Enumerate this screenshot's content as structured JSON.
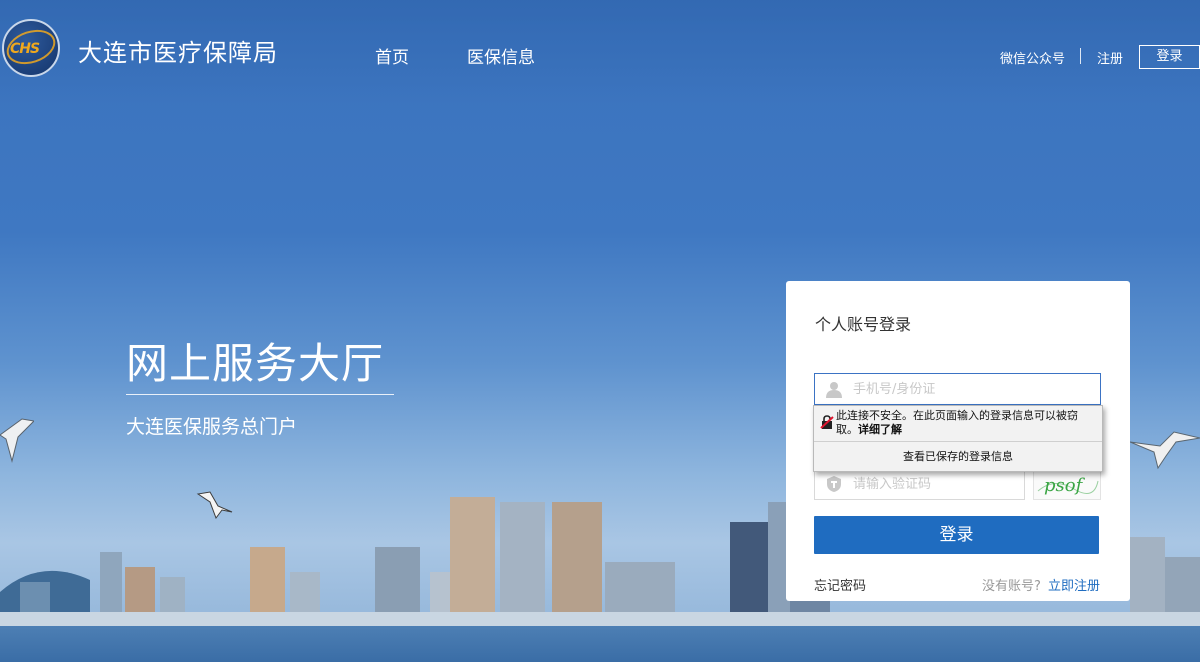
{
  "header": {
    "site_title": "大连市医疗保障局",
    "logo_text": "CHS",
    "nav": {
      "home": "首页",
      "medical_info": "医保信息"
    },
    "links": {
      "wechat": "微信公众号",
      "register": "注册",
      "login": "登录"
    }
  },
  "hero": {
    "title": "网上服务大厅",
    "subtitle": "大连医保服务总门户"
  },
  "login_panel": {
    "title": "个人账号登录",
    "username_placeholder": "手机号/身份证",
    "code_placeholder": "请输入验证码",
    "captcha_text": "psof",
    "login_button": "登录",
    "forgot_password": "忘记密码",
    "no_account": "没有账号?",
    "register_now": "立即注册"
  },
  "browser_popup": {
    "warning": "此连接不安全。在此页面输入的登录信息可以被窃取。",
    "learn_more": "详细了解",
    "view_saved": "查看已保存的登录信息"
  },
  "colors": {
    "brand_blue": "#1f6cc0",
    "sky_top": "#3a72bd",
    "logo_orange": "#f0a81d"
  }
}
